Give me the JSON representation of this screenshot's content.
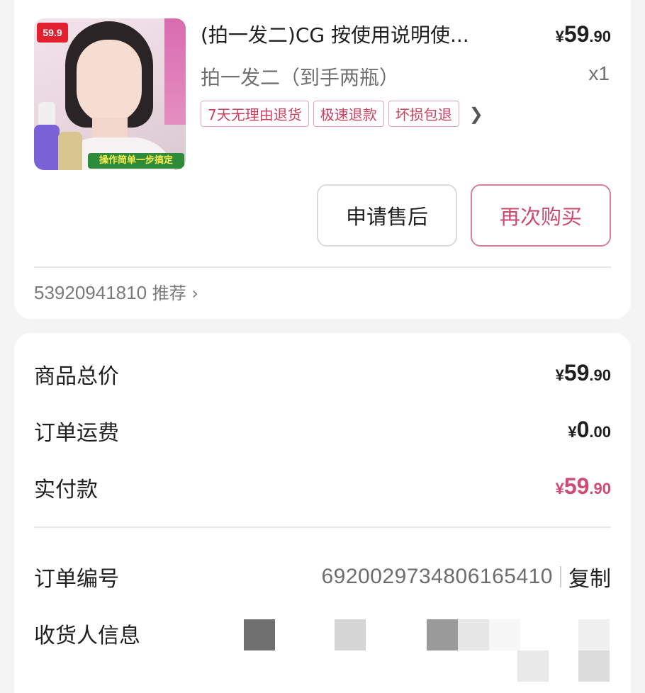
{
  "product": {
    "image_badge": "59.9",
    "image_slogan": "操作简单一步搞定",
    "title": "(拍一发二)CG 按使用说明使...",
    "price": {
      "symbol": "¥",
      "int": "59",
      "dec": ".90"
    },
    "variant": "拍一发二（到手两瓶）",
    "quantity": "x1",
    "tags": [
      "7天无理由退货",
      "极速退款",
      "坏损包退"
    ],
    "tags_more_icon": "chevron-right-icon"
  },
  "actions": {
    "after_sale_label": "申请售后",
    "rebuy_label": "再次购买"
  },
  "recommend": {
    "id": "53920941810",
    "label": "推荐",
    "arrow": "›"
  },
  "summary": {
    "goods_total_label": "商品总价",
    "goods_total": {
      "symbol": "¥",
      "int": "59",
      "dec": ".90"
    },
    "shipping_label": "订单运费",
    "shipping": {
      "symbol": "¥",
      "int": "0",
      "dec": ".00"
    },
    "paid_label": "实付款",
    "paid": {
      "symbol": "¥",
      "int": "59",
      "dec": ".90"
    }
  },
  "order": {
    "number_label": "订单编号",
    "number": "6920029734806165410",
    "copy_label": "复制",
    "receiver_label": "收货人信息"
  },
  "colors": {
    "accent": "#c94a6c",
    "tag_border": "#e3a5b3",
    "paid_price": "#d04a71"
  }
}
